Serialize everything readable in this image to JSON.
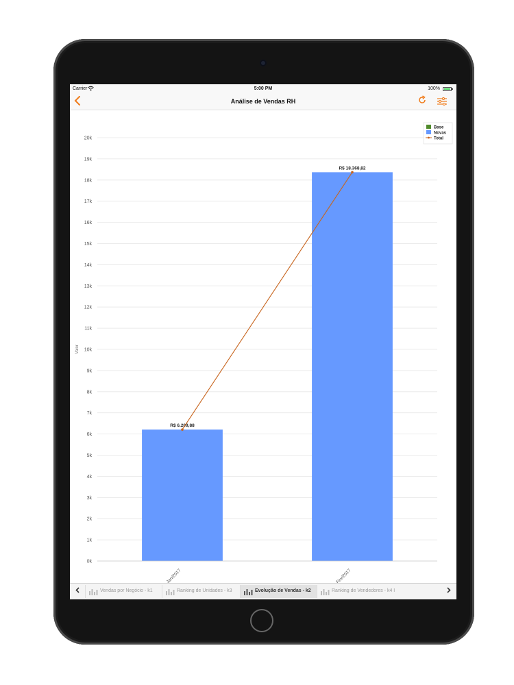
{
  "status_bar": {
    "carrier": "Carrier",
    "time": "5:00 PM",
    "battery": "100%"
  },
  "nav": {
    "back_icon": "chevron-left-icon",
    "title": "Análise de Vendas RH",
    "refresh_icon": "refresh-icon",
    "filters_icon": "filters-icon"
  },
  "colors": {
    "accent": "#f07c1c",
    "base": "#4f8a2a",
    "novas": "#6699ff",
    "total": "#c8651e"
  },
  "chart_data": {
    "type": "bar",
    "categories": [
      "Jan/2017",
      "Fev/2017"
    ],
    "series": [
      {
        "name": "Base",
        "values": [
          0,
          0
        ]
      },
      {
        "name": "Novas",
        "values": [
          6209.88,
          18368.82
        ]
      },
      {
        "name": "Total",
        "type": "line",
        "values": [
          6209.88,
          18368.82
        ]
      }
    ],
    "data_labels": [
      "R$ 6.209,88",
      "R$ 18.368,82"
    ],
    "ylabel": "Valor",
    "xlabel": "",
    "ylim": [
      0,
      20000
    ],
    "yticks": [
      0,
      1000,
      2000,
      3000,
      4000,
      5000,
      6000,
      7000,
      8000,
      9000,
      10000,
      11000,
      12000,
      13000,
      14000,
      15000,
      16000,
      17000,
      18000,
      19000,
      20000
    ],
    "ytick_labels": [
      "0k",
      "1k",
      "2k",
      "3k",
      "4k",
      "5k",
      "6k",
      "7k",
      "8k",
      "9k",
      "10k",
      "11k",
      "12k",
      "13k",
      "14k",
      "15k",
      "16k",
      "17k",
      "18k",
      "19k",
      "20k"
    ],
    "grid": true,
    "legend": "top-right"
  },
  "tabs": [
    {
      "label": "Vendas por Negócio - k1",
      "active": false
    },
    {
      "label": "Ranking de Unidades - k3",
      "active": false
    },
    {
      "label": "Evolução de Vendas - k2",
      "active": true
    },
    {
      "label": "Ranking de Vendedores - k4 I",
      "active": false
    }
  ],
  "tab_nav": {
    "prev_icon": "chevron-left-icon",
    "next_icon": "chevron-right-icon"
  }
}
